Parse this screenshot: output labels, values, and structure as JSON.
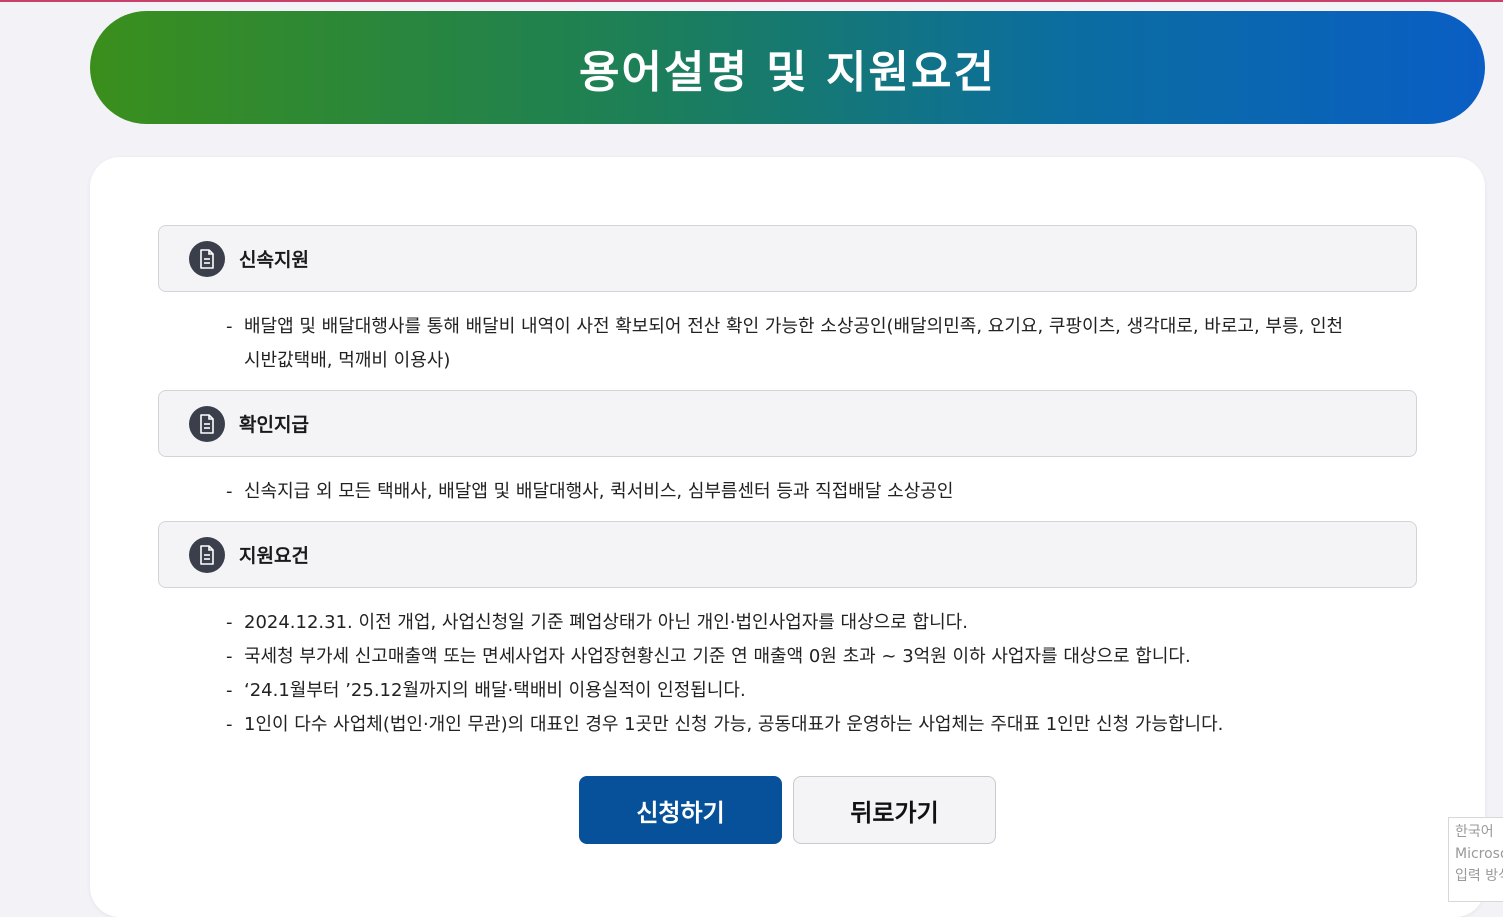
{
  "banner": {
    "title": "용어설명 및 지원요건"
  },
  "sections": [
    {
      "title": "신속지원",
      "items": [
        "배달앱 및 배달대행사를 통해 배달비 내역이 사전 확보되어 전산 확인 가능한 소상공인(배달의민족, 요기요, 쿠팡이츠, 생각대로, 바로고, 부릉, 인천시반값택배, 먹깨비 이용사)"
      ]
    },
    {
      "title": "확인지급",
      "items": [
        "신속지급 외 모든 택배사, 배달앱 및 배달대행사, 퀵서비스, 심부름센터 등과 직접배달 소상공인"
      ]
    },
    {
      "title": "지원요건",
      "items": [
        "2024.12.31. 이전 개업, 사업신청일 기준 폐업상태가 아닌 개인·법인사업자를 대상으로 합니다.",
        "국세청 부가세 신고매출액 또는 면세사업자 사업장현황신고 기준 연 매출액 0원 초과 ~ 3억원 이하 사업자를 대상으로 합니다.",
        "‘24.1월부터 ’25.12월까지의 배달·택배비 이용실적이 인정됩니다.",
        "1인이 다수 사업체(법인·개인 무관)의 대표인 경우 1곳만 신청 가능, 공동대표가 운영하는 사업체는 주대표 1인만 신청 가능합니다."
      ]
    }
  ],
  "bullet": "-",
  "buttons": {
    "apply": "신청하기",
    "back": "뒤로가기"
  },
  "lang_popup": {
    "line1": "한국어",
    "line2": "Microsoft",
    "line3": "입력 방식"
  },
  "colors": {
    "banner_start": "#3a8f1c",
    "banner_end": "#0a5ec4",
    "apply_button": "#07509a"
  }
}
